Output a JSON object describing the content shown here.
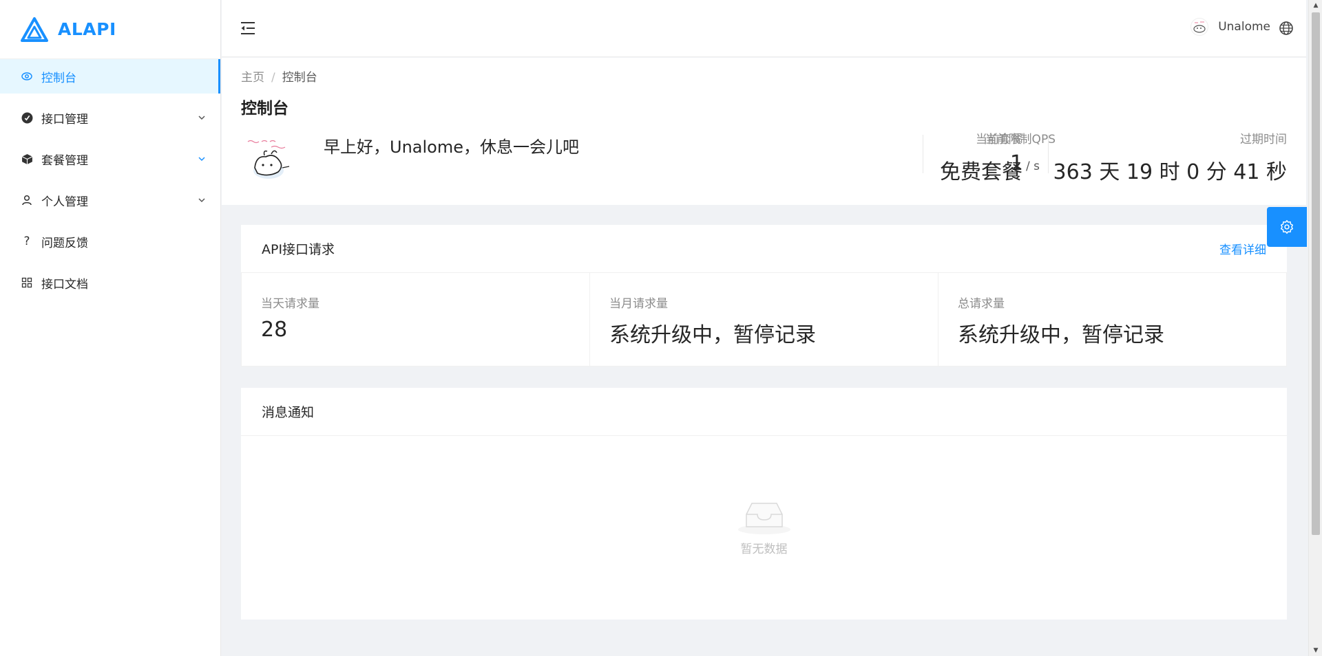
{
  "brand": {
    "name": "ALAPI"
  },
  "sidebar": {
    "items": [
      {
        "label": "控制台",
        "icon": "dashboard-icon",
        "active": true,
        "expandable": false
      },
      {
        "label": "接口管理",
        "icon": "api-icon",
        "active": false,
        "expandable": true
      },
      {
        "label": "套餐管理",
        "icon": "package-icon",
        "active": false,
        "expandable": true
      },
      {
        "label": "个人管理",
        "icon": "user-icon",
        "active": false,
        "expandable": true
      },
      {
        "label": "问题反馈",
        "icon": "question-icon",
        "active": false,
        "expandable": false
      },
      {
        "label": "接口文档",
        "icon": "docs-grid-icon",
        "active": false,
        "expandable": false
      }
    ]
  },
  "header": {
    "username": "Unalome"
  },
  "breadcrumb": {
    "home": "主页",
    "separator": "/",
    "current": "控制台"
  },
  "page": {
    "title": "控制台",
    "greeting": "早上好，Unalome，休息一会儿吧",
    "stats": {
      "plan_label": "当前套餐",
      "plan_value": "免费套餐",
      "qps_label": "当前限制QPS",
      "qps_value": "1",
      "qps_unit": "/ s",
      "expire_label": "过期时间",
      "expire_value": "363 天 19 时 0 分 41 秒"
    }
  },
  "api_card": {
    "title": "API接口请求",
    "link": "查看详细",
    "cells": [
      {
        "label": "当天请求量",
        "value": "28"
      },
      {
        "label": "当月请求量",
        "value": "系统升级中，暂停记录"
      },
      {
        "label": "总请求量",
        "value": "系统升级中，暂停记录"
      }
    ]
  },
  "notice_card": {
    "title": "消息通知",
    "empty_text": "暂无数据"
  },
  "colors": {
    "primary": "#1890ff",
    "active_bg": "#e6f7ff"
  }
}
